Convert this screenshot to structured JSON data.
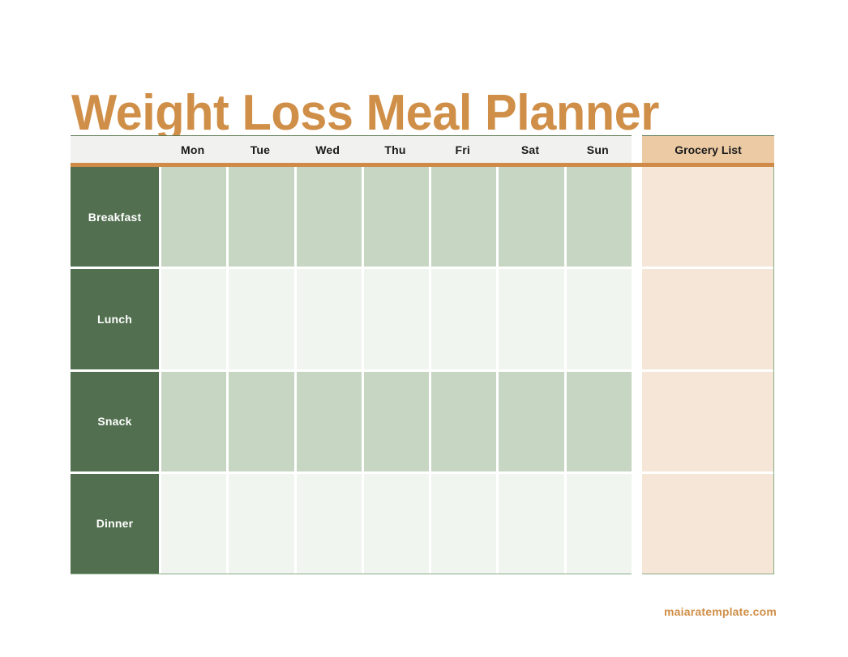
{
  "page": {
    "title": "Weight Loss Meal Planner",
    "footer_credit": "maiaratemplate.com"
  },
  "planner": {
    "corner_label": "",
    "day_headers": [
      "Mon",
      "Tue",
      "Wed",
      "Thu",
      "Fri",
      "Sat",
      "Sun"
    ],
    "meal_rows": [
      {
        "label": "Breakfast",
        "tint": "dark",
        "cells": [
          "",
          "",
          "",
          "",
          "",
          "",
          ""
        ]
      },
      {
        "label": "Lunch",
        "tint": "light",
        "cells": [
          "",
          "",
          "",
          "",
          "",
          "",
          ""
        ]
      },
      {
        "label": "Snack",
        "tint": "dark",
        "cells": [
          "",
          "",
          "",
          "",
          "",
          "",
          ""
        ]
      },
      {
        "label": "Dinner",
        "tint": "light",
        "cells": [
          "",
          "",
          "",
          "",
          "",
          "",
          ""
        ]
      }
    ],
    "grocery": {
      "header": "Grocery List",
      "cells": [
        "",
        "",
        "",
        ""
      ]
    }
  },
  "colors": {
    "title_orange": "#d08f48",
    "rule_orange": "#cf8a48",
    "label_green": "#527050",
    "border_green": "#8aab86",
    "cell_green_dark": "#c6d6c2",
    "cell_green_light": "#f0f5f0",
    "grocery_header_tan": "#eccba4",
    "grocery_cell_peach": "#f5e6d7",
    "header_gray": "#f1f1f0"
  }
}
